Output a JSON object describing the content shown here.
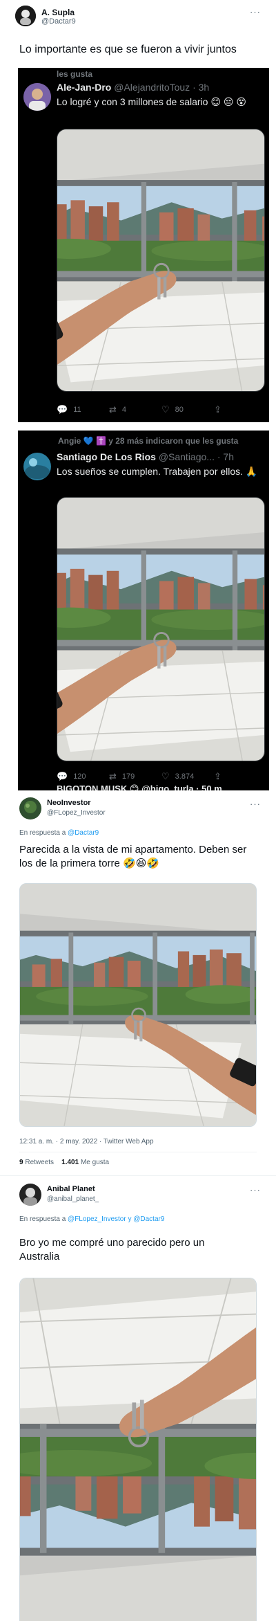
{
  "main_tweet": {
    "name": "A. Supla",
    "handle": "@Dactar9",
    "text": "Lo importante es que se fueron a vivir juntos",
    "more": "···"
  },
  "shot1": {
    "liked_line": "les gusta",
    "name": "Ale-Jan-Dro",
    "handle": "@AlejandritoTouz · 3h",
    "text": "Lo logré y con 3 millones de salario 😊 😔 😵",
    "replies": "11",
    "retweets": "4",
    "likes": "80"
  },
  "shot2": {
    "liked_line": "Angie 💙 ✝️ y 28 más indicaron que les gusta",
    "name": "Santiago De Los Rios",
    "handle": "@Santiago... · 7h",
    "text": "Los sueños se cumplen. Trabajen por ellos. 🙏",
    "replies": "120",
    "retweets": "179",
    "likes": "3.874",
    "peek": "BIGOTON MUSK 😊 @bigo_turla · 50 m"
  },
  "reply1": {
    "name": "NeoInvestor",
    "handle": "@FLopez_Investor",
    "reply_prefix": "En respuesta a",
    "reply_to": "@Dactar9",
    "text": "Parecida a la vista de mi apartamento. Deben ser los de la primera torre 🤣😆🤣",
    "meta": "12:31 a. m. · 2 may. 2022 · Twitter Web App",
    "retweets_count": "9",
    "retweets_label": "Retweets",
    "likes_count": "1.401",
    "likes_label": "Me gusta",
    "more": "···"
  },
  "reply2": {
    "name": "Anibal Planet",
    "handle": "@anibal_planet_",
    "reply_prefix": "En respuesta a",
    "reply_to": "@FLopez_Investor y @Dactar9",
    "text": "Bro yo me compré uno parecido pero un Australia",
    "more": "···"
  },
  "colors": {
    "link": "#1d9bf0",
    "dark_bg": "#000000",
    "dark_text": "#e7e9ea",
    "muted": "#536471"
  }
}
